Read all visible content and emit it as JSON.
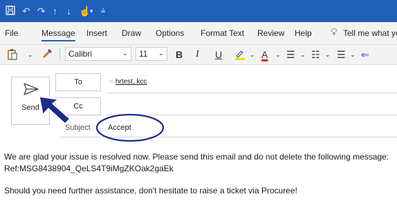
{
  "quick_access": {
    "icons": [
      "save-icon",
      "undo-icon",
      "redo-icon",
      "up-arrow-icon",
      "down-arrow-icon",
      "touch-mode-icon",
      "customize-toolbar-icon"
    ]
  },
  "tabs": [
    {
      "label": "File"
    },
    {
      "label": "Message"
    },
    {
      "label": "Insert"
    },
    {
      "label": "Draw"
    },
    {
      "label": "Options"
    },
    {
      "label": "Format Text"
    },
    {
      "label": "Review"
    },
    {
      "label": "Help"
    },
    {
      "label": "Tell me what yo"
    }
  ],
  "ribbon": {
    "font_name": "Calibri",
    "font_size": "11",
    "bold": "B",
    "italic": "I",
    "underline": "U",
    "font_color_letter": "A"
  },
  "compose": {
    "send_label": "Send",
    "to_label": "To",
    "cc_label": "Cc",
    "recipient": "hrtest, kcc",
    "subject_label": "Subject",
    "subject_value": "Accept"
  },
  "message_body": {
    "line1": "We are glad your issue is resolved now. Please send this email and do not delete the following message:",
    "line2": "Ref:MSG8438904_QeLS4T9iMgZKOak2gaEk",
    "line3": "Should you need further  assistance, don't hesitate to raise a ticket via Procuree!"
  },
  "colors": {
    "titlebar": "#1f5fb9",
    "highlight_yellow": "#f5d800",
    "font_red": "#d92020",
    "annotation_navy": "#1d2b8a"
  }
}
